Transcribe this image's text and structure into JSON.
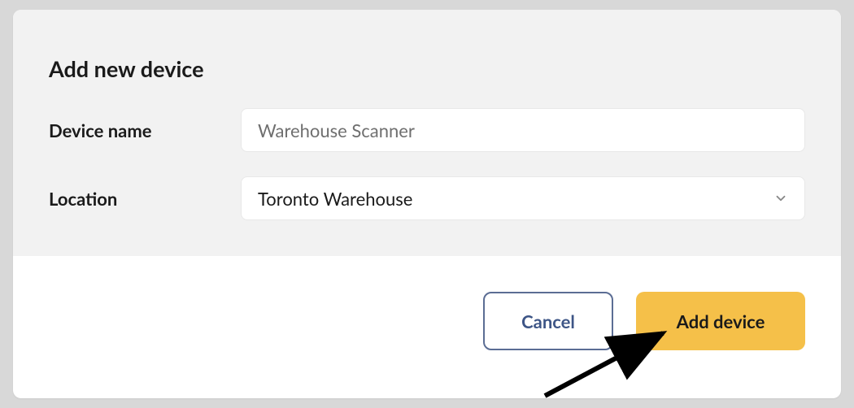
{
  "modal": {
    "title": "Add new device",
    "deviceName": {
      "label": "Device name",
      "placeholder": "Warehouse Scanner",
      "value": ""
    },
    "location": {
      "label": "Location",
      "selected": "Toronto Warehouse"
    },
    "buttons": {
      "cancel": "Cancel",
      "submit": "Add device"
    }
  }
}
